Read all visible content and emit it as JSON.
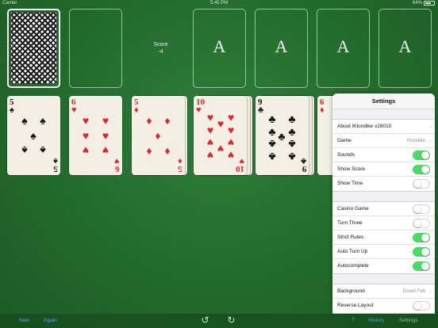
{
  "status": {
    "carrier": "Carrier",
    "time": "5:45 PM",
    "battery": "64%"
  },
  "score": {
    "label": "Score",
    "value": "-4"
  },
  "foundations": [
    "A",
    "A",
    "A",
    "A"
  ],
  "tableau": [
    {
      "rank": "5",
      "suit": "♠",
      "color": "black"
    },
    {
      "rank": "6",
      "suit": "♥",
      "color": "red"
    },
    {
      "rank": "5",
      "suit": "♦",
      "color": "red"
    },
    {
      "rank": "10",
      "suit": "♥",
      "color": "red"
    },
    {
      "rank": "9",
      "suit": "♣",
      "color": "black"
    },
    {
      "rank": "6",
      "suit": "♦",
      "color": "red"
    }
  ],
  "settings": {
    "title": "Settings",
    "about": "About iKlondike v28010",
    "game_label": "Game",
    "game_value": "Klondike",
    "sounds": "Sounds",
    "show_score": "Show Score",
    "show_time": "Show Time",
    "casino_game": "Casino Game",
    "turn_three": "Turn Three",
    "strict_rules": "Strict Rules",
    "auto_turn_up": "Auto Turn Up",
    "autocomplete": "Autocomplete",
    "background_label": "Background",
    "background_value": "Green Felt",
    "reverse_layout": "Reverse Layout",
    "toggles": {
      "sounds": true,
      "show_score": true,
      "show_time": false,
      "casino_game": false,
      "turn_three": false,
      "strict_rules": true,
      "auto_turn_up": true,
      "autocomplete": true,
      "reverse_layout": false
    }
  },
  "toolbar": {
    "new": "New",
    "again": "Again",
    "help": "?",
    "history": "History",
    "settings": "Settings"
  },
  "colors": {
    "felt": "#236a2d",
    "accent": "#4aa3ff",
    "toggle_on": "#4cd964",
    "red_suit": "#e0262d"
  }
}
